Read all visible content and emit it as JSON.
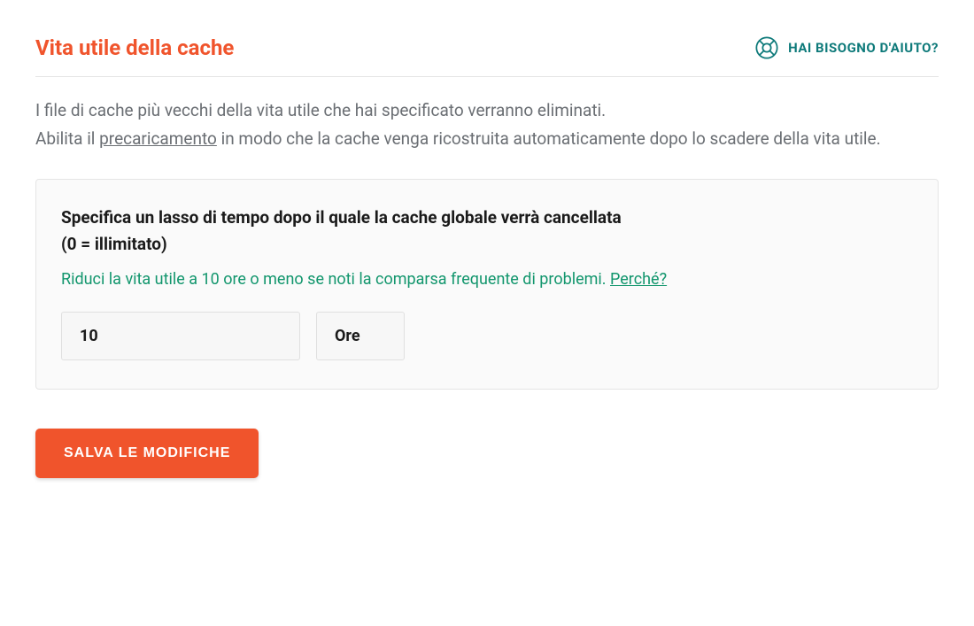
{
  "header": {
    "title": "Vita utile della cache",
    "help_label": "HAI BISOGNO D'AIUTO?"
  },
  "description": {
    "line1": "I file di cache più vecchi della vita utile che hai specificato verranno eliminati.",
    "line2_prefix": "Abilita il ",
    "line2_link": "precaricamento",
    "line2_suffix": " in modo che la cache venga ricostruita automaticamente dopo lo scadere della vita utile."
  },
  "settings": {
    "heading_line1": "Specifica un lasso di tempo dopo il quale la cache globale verrà cancellata",
    "heading_line2": "(0 = illimitato)",
    "hint_text": "Riduci la vita utile a 10 ore o meno se noti la comparsa frequente di problemi. ",
    "hint_link": "Perché?",
    "value": "10",
    "unit": "Ore"
  },
  "actions": {
    "save_label": "SALVA LE MODIFICHE"
  }
}
